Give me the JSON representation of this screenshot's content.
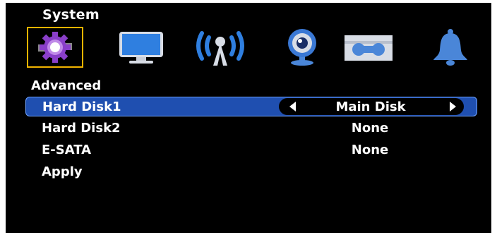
{
  "header": {
    "title": "System"
  },
  "icons": [
    {
      "name": "system-gear-icon",
      "selected": true
    },
    {
      "name": "display-monitor-icon",
      "selected": false
    },
    {
      "name": "network-antenna-icon",
      "selected": false
    },
    {
      "name": "camera-icon",
      "selected": false
    },
    {
      "name": "storage-disk-icon",
      "selected": false
    },
    {
      "name": "alarm-bell-icon",
      "selected": false
    }
  ],
  "section": {
    "title": "Advanced"
  },
  "settings": [
    {
      "label": "Hard Disk1",
      "value": "Main Disk",
      "selected": true
    },
    {
      "label": "Hard Disk2",
      "value": "None",
      "selected": false
    },
    {
      "label": "E-SATA",
      "value": "None",
      "selected": false
    },
    {
      "label": "Apply",
      "value": "",
      "selected": false
    }
  ],
  "colors": {
    "highlight": "#1f4fb0",
    "selected_icon_border": "#f2b400",
    "gear": "#8a3fc9"
  }
}
